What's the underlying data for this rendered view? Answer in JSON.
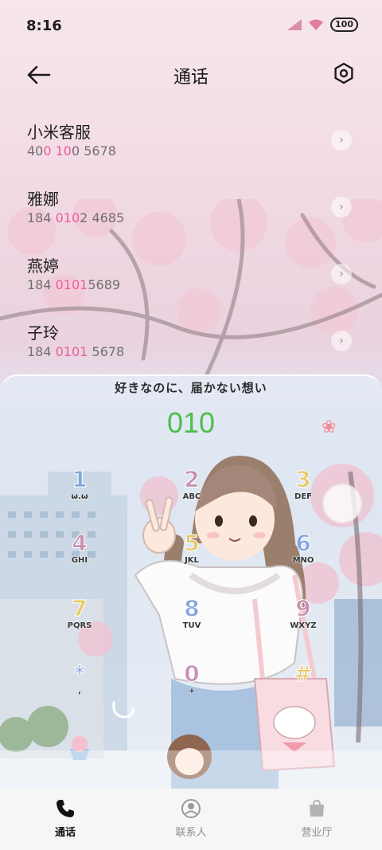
{
  "status": {
    "time": "8:16",
    "battery": "100"
  },
  "header": {
    "title": "通话"
  },
  "contacts": [
    {
      "name": "小米客服",
      "num_pre": "40",
      "num_hl": "0 10",
      "num_post": "0 5678"
    },
    {
      "name": "雅娜",
      "num_pre": "184 ",
      "num_hl": "010",
      "num_post": "2 4685"
    },
    {
      "name": "燕婷",
      "num_pre": "184 ",
      "num_hl": "0101",
      "num_post": "5689"
    },
    {
      "name": "子玲",
      "num_pre": "184 ",
      "num_hl": "0101",
      "num_post": " 5678"
    }
  ],
  "dialer": {
    "slogan": "好きなのに、届かない想い",
    "digits": "010",
    "keys": [
      {
        "d": "1",
        "l": "ω.ω"
      },
      {
        "d": "2",
        "l": "ABC"
      },
      {
        "d": "3",
        "l": "DEF"
      },
      {
        "d": "4",
        "l": "GHI"
      },
      {
        "d": "5",
        "l": "JKL"
      },
      {
        "d": "6",
        "l": "MNO"
      },
      {
        "d": "7",
        "l": "PQRS"
      },
      {
        "d": "8",
        "l": "TUV"
      },
      {
        "d": "9",
        "l": "WXYZ"
      },
      {
        "d": "*",
        "l": ","
      },
      {
        "d": "0",
        "l": "+"
      },
      {
        "d": "#",
        "l": ""
      }
    ],
    "key_colors": [
      "#7fa6e0",
      "#c98fb0",
      "#e8c86a",
      "#c98fb0",
      "#e8c86a",
      "#7fa6e0",
      "#e8c86a",
      "#7fa6e0",
      "#c98fb0",
      "#7fa6e0",
      "#c98fb0",
      "#e8c86a"
    ]
  },
  "tabs": [
    {
      "label": "通话",
      "icon": "phone-icon"
    },
    {
      "label": "联系人",
      "icon": "person-icon"
    },
    {
      "label": "营业厅",
      "icon": "bag-icon"
    }
  ]
}
